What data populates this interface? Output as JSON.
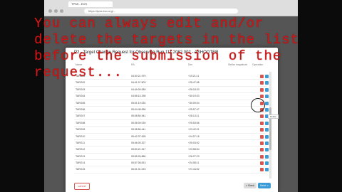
{
  "browser": {
    "tab_title": "TPSS - EVS",
    "address": "https://tpss.eso.org/..."
  },
  "modal": {
    "title": "P2 - Target Change Request for Observing Run 111.2082.002 - ASHOOTER",
    "columns": [
      "Name",
      "RA",
      "Dec",
      "Stellar magnitude",
      "",
      "Operation"
    ],
    "rows": [
      {
        "name": "TARG01",
        "ra": "04:40:21.979",
        "dec": "+19:21:11"
      },
      {
        "name": "TARG02",
        "ra": "04:41:07.603",
        "dec": "+25:47:58"
      },
      {
        "name": "TARG03",
        "ra": "04:49:09.089",
        "dec": "+26:18:33"
      },
      {
        "name": "TARG04",
        "ra": "04:55:10.298",
        "dec": "+30:19:03"
      },
      {
        "name": "TARG05",
        "ra": "05:01:19.034",
        "dec": "+30:09:04"
      },
      {
        "name": "TARG06",
        "ra": "05:04:48.836",
        "dec": "+25:57:47"
      },
      {
        "name": "TARG07",
        "ra": "05:08:50.941",
        "dec": "+28:13:11"
      },
      {
        "name": "TARG08",
        "ra": "05:36:09.039",
        "dec": "+25:53:56"
      },
      {
        "name": "TARG09",
        "ra": "05:38:56.441",
        "dec": "+23:42:21"
      },
      {
        "name": "TARG10",
        "ra": "05:42:37.628",
        "dec": "+24:07:16"
      },
      {
        "name": "TARG11",
        "ra": "05:46:00.327",
        "dec": "+25:03:02"
      },
      {
        "name": "TARG12",
        "ra": "05:50:21.917",
        "dec": "+23:58:54"
      },
      {
        "name": "TARG13",
        "ra": "05:55:26.886",
        "dec": "+26:27:23"
      },
      {
        "name": "TARG14",
        "ra": "05:57:08.813",
        "dec": "+24:08:11"
      },
      {
        "name": "TARG15",
        "ra": "06:01:31.023",
        "dec": "+21:44:52"
      }
    ],
    "tooltip": "Delete",
    "cancel_label": "cancel",
    "back_label": "< Back",
    "next_label": "Next >"
  },
  "caption": "You can always edit and/or delete the targets in the list before the submission of the request..."
}
